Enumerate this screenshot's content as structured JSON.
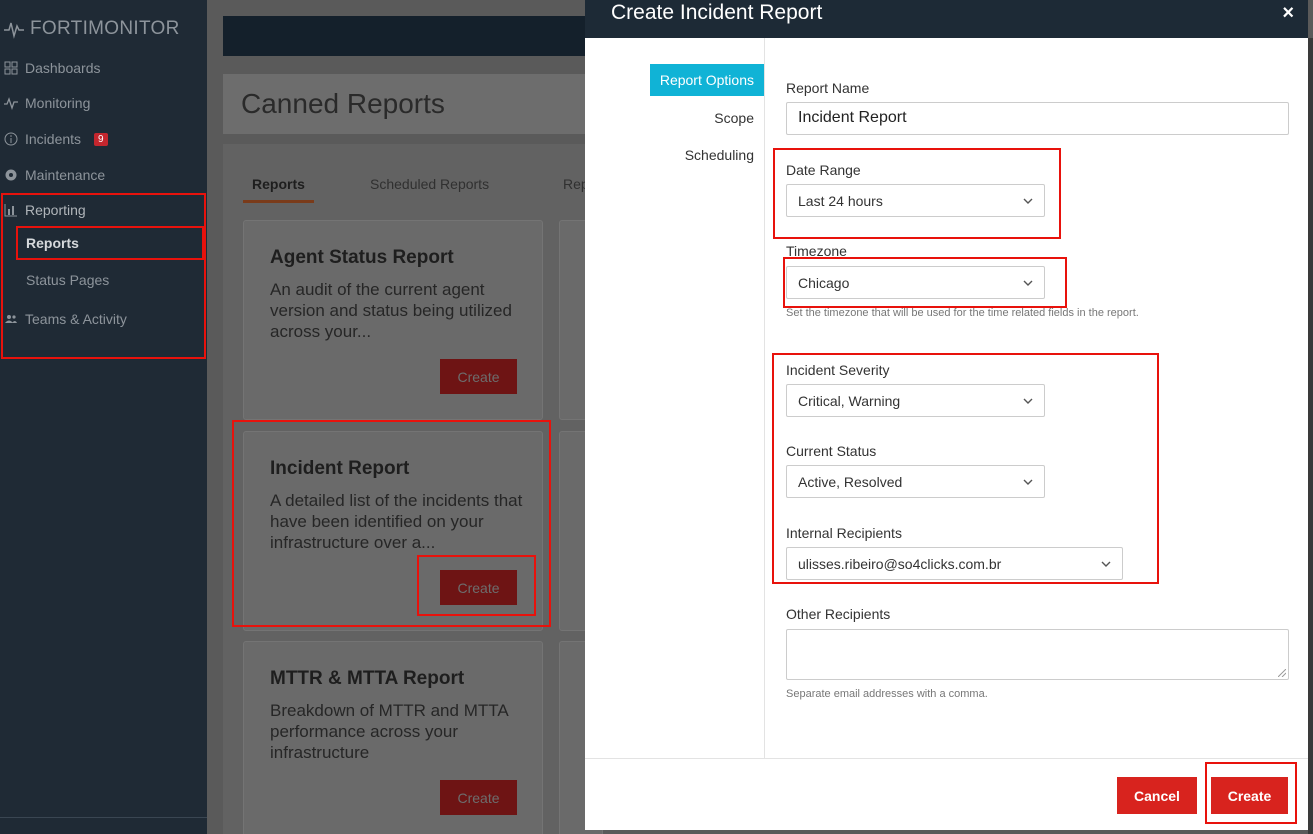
{
  "sidebar": {
    "app_name": "FORTIMONITOR",
    "items": [
      {
        "label": "Dashboards",
        "icon": "grid-icon"
      },
      {
        "label": "Monitoring",
        "icon": "pulse-icon"
      },
      {
        "label": "Incidents",
        "icon": "info-circle-icon",
        "badge": "9"
      },
      {
        "label": "Maintenance",
        "icon": "gear-icon"
      },
      {
        "label": "Reporting",
        "icon": "bar-chart-icon"
      }
    ],
    "reporting_sub": [
      {
        "label": "Reports"
      },
      {
        "label": "Status Pages"
      }
    ],
    "teams": {
      "label": "Teams & Activity",
      "icon": "users-icon"
    }
  },
  "main": {
    "page_title": "Canned Reports",
    "tabs": [
      {
        "label": "Reports"
      },
      {
        "label": "Scheduled Reports"
      },
      {
        "label": "Rep"
      }
    ],
    "cards": [
      {
        "title": "Agent Status Report",
        "description": "An audit of the current agent version and status being utilized across your...",
        "button": "Create"
      },
      {
        "title": "Incident Report",
        "description": "A detailed list of the incidents that have been identified on your infrastructure over a...",
        "button": "Create"
      },
      {
        "title": "MTTR & MTTA Report",
        "description": "Breakdown of MTTR and MTTA performance across your infrastructure",
        "button": "Create"
      }
    ]
  },
  "modal": {
    "title": "Create Incident Report",
    "close": "×",
    "side_tabs": [
      "Report Options",
      "Scope",
      "Scheduling"
    ],
    "fields": {
      "report_name": {
        "label": "Report Name",
        "value": "Incident Report"
      },
      "date_range": {
        "label": "Date Range",
        "value": "Last 24 hours"
      },
      "timezone": {
        "label": "Timezone",
        "value": "Chicago",
        "help": "Set the timezone that will be used for the time related fields in the report."
      },
      "severity": {
        "label": "Incident Severity",
        "value": "Critical, Warning"
      },
      "status": {
        "label": "Current Status",
        "value": "Active, Resolved"
      },
      "internal": {
        "label": "Internal Recipients",
        "value": "ulisses.ribeiro@so4clicks.com.br"
      },
      "other": {
        "label": "Other Recipients",
        "help": "Separate email addresses with a comma."
      }
    },
    "buttons": {
      "cancel": "Cancel",
      "create": "Create"
    }
  },
  "colors": {
    "accent": "#10b3d6",
    "primary_button": "#d8231e",
    "header": "#1d2a36",
    "highlight": "#e8120c"
  }
}
